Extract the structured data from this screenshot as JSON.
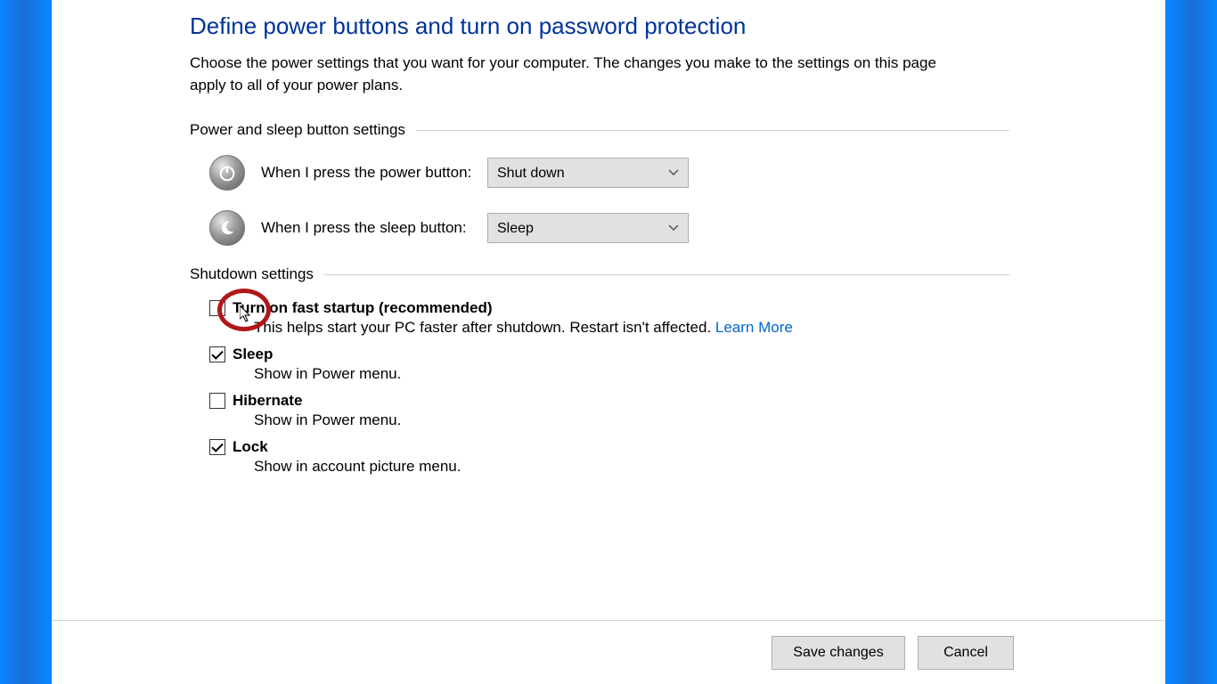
{
  "page": {
    "title": "Define power buttons and turn on password protection",
    "description": "Choose the power settings that you want for your computer. The changes you make to the settings on this page apply to all of your power plans."
  },
  "sections": {
    "buttons_heading": "Power and sleep button settings",
    "shutdown_heading": "Shutdown settings"
  },
  "power_button": {
    "label": "When I press the power button:",
    "value": "Shut down"
  },
  "sleep_button": {
    "label": "When I press the sleep button:",
    "value": "Sleep"
  },
  "shutdown_options": {
    "fast_startup": {
      "title": "Turn on fast startup (recommended)",
      "desc": "This helps start your PC faster after shutdown. Restart isn't affected. ",
      "link": "Learn More",
      "checked": false
    },
    "sleep": {
      "title": "Sleep",
      "desc": "Show in Power menu.",
      "checked": true
    },
    "hibernate": {
      "title": "Hibernate",
      "desc": "Show in Power menu.",
      "checked": false
    },
    "lock": {
      "title": "Lock",
      "desc": "Show in account picture menu.",
      "checked": true
    }
  },
  "footer": {
    "save": "Save changes",
    "cancel": "Cancel"
  }
}
